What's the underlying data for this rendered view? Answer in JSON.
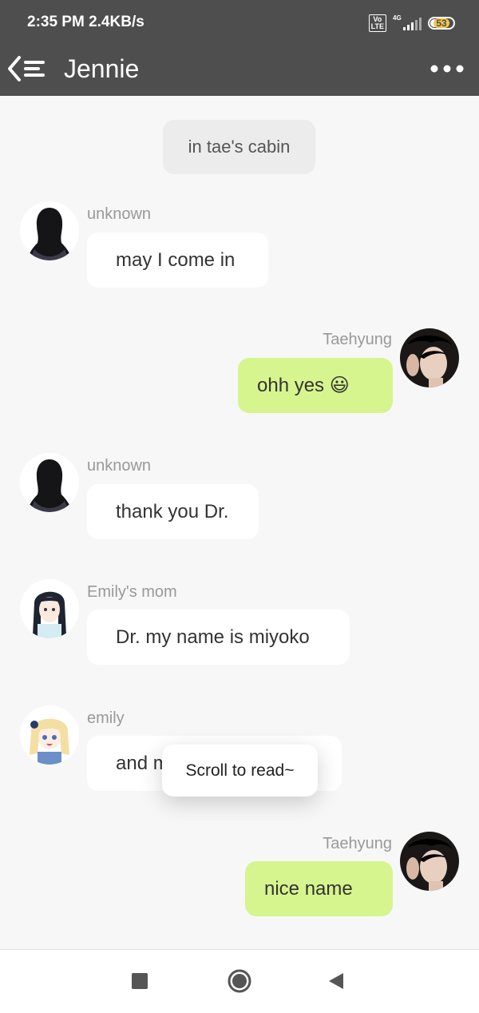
{
  "status_bar": {
    "time_speed": "2:35 PM  2.4KB/s",
    "volte": "Vo LTE",
    "network": "4G",
    "battery": "53"
  },
  "header": {
    "title": "Jennie"
  },
  "scene_note": "in tae's cabin",
  "messages": [
    {
      "sender": "unknown",
      "text": "may I come in",
      "side": "left"
    },
    {
      "sender": "Taehyung",
      "text": "ohh yes 😃",
      "side": "right"
    },
    {
      "sender": "unknown",
      "text": "thank you Dr.",
      "side": "left"
    },
    {
      "sender": "Emily's mom",
      "text": "Dr. my name is miyoko",
      "side": "left"
    },
    {
      "sender": "emily",
      "text": "and my name is emily",
      "side": "left"
    },
    {
      "sender": "Taehyung",
      "text": "nice name",
      "side": "right"
    }
  ],
  "toast": "Scroll to read~",
  "colors": {
    "bar": "#4e4e4e",
    "outgoing_bubble": "#d6f58e",
    "incoming_bubble": "#ffffff",
    "background": "#f7f7f7"
  },
  "icons": {
    "back": "back-menu-icon",
    "more": "more-dots-icon",
    "recents": "square-icon",
    "home": "circle-icon",
    "nav_back": "triangle-icon"
  }
}
